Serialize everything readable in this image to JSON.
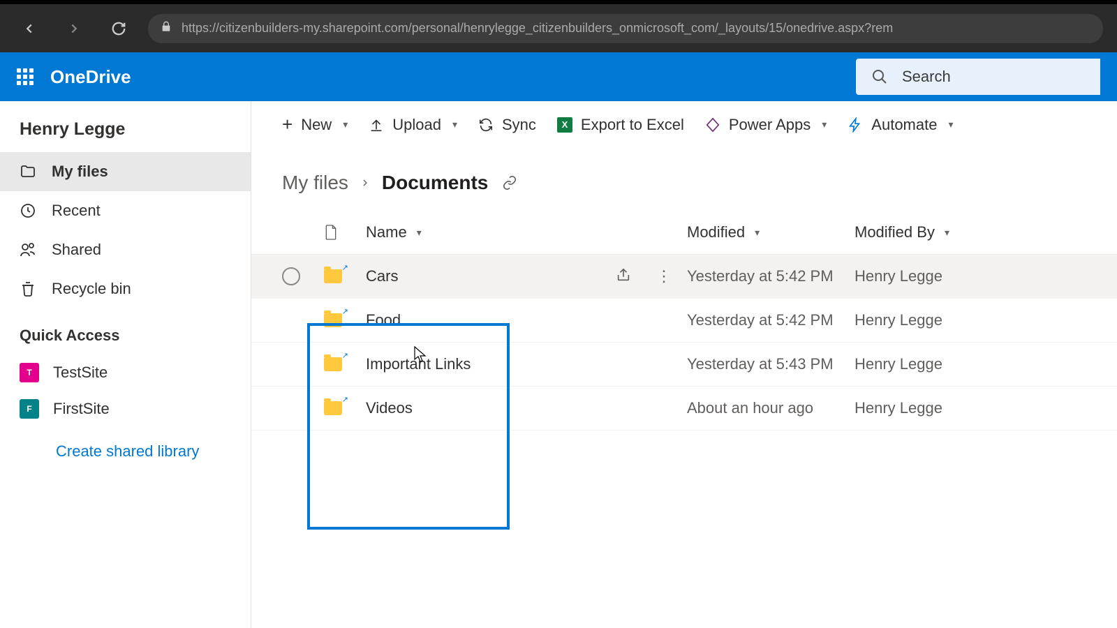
{
  "browser": {
    "url": "https://citizenbuilders-my.sharepoint.com/personal/henrylegge_citizenbuilders_onmicrosoft_com/_layouts/15/onedrive.aspx?rem"
  },
  "header": {
    "app_title": "OneDrive",
    "search_placeholder": "Search"
  },
  "sidebar": {
    "user": "Henry Legge",
    "items": [
      {
        "label": "My files",
        "icon": "files-icon",
        "active": true
      },
      {
        "label": "Recent",
        "icon": "clock-icon",
        "active": false
      },
      {
        "label": "Shared",
        "icon": "people-icon",
        "active": false
      },
      {
        "label": "Recycle bin",
        "icon": "trash-icon",
        "active": false
      }
    ],
    "quick_access_heading": "Quick Access",
    "sites": [
      {
        "label": "TestSite",
        "color": "pink",
        "initial": "T"
      },
      {
        "label": "FirstSite",
        "color": "teal",
        "initial": "F"
      }
    ],
    "create_link": "Create shared library"
  },
  "toolbar": {
    "new_label": "New",
    "upload_label": "Upload",
    "sync_label": "Sync",
    "export_label": "Export to Excel",
    "power_apps_label": "Power Apps",
    "automate_label": "Automate"
  },
  "breadcrumb": {
    "root": "My files",
    "current": "Documents"
  },
  "table": {
    "columns": {
      "name": "Name",
      "modified": "Modified",
      "modified_by": "Modified By"
    },
    "rows": [
      {
        "name": "Cars",
        "modified": "Yesterday at 5:42 PM",
        "modified_by": "Henry Legge",
        "hover": true
      },
      {
        "name": "Food",
        "modified": "Yesterday at 5:42 PM",
        "modified_by": "Henry Legge",
        "hover": false
      },
      {
        "name": "Important Links",
        "modified": "Yesterday at 5:43 PM",
        "modified_by": "Henry Legge",
        "hover": false
      },
      {
        "name": "Videos",
        "modified": "About an hour ago",
        "modified_by": "Henry Legge",
        "hover": false
      }
    ]
  }
}
